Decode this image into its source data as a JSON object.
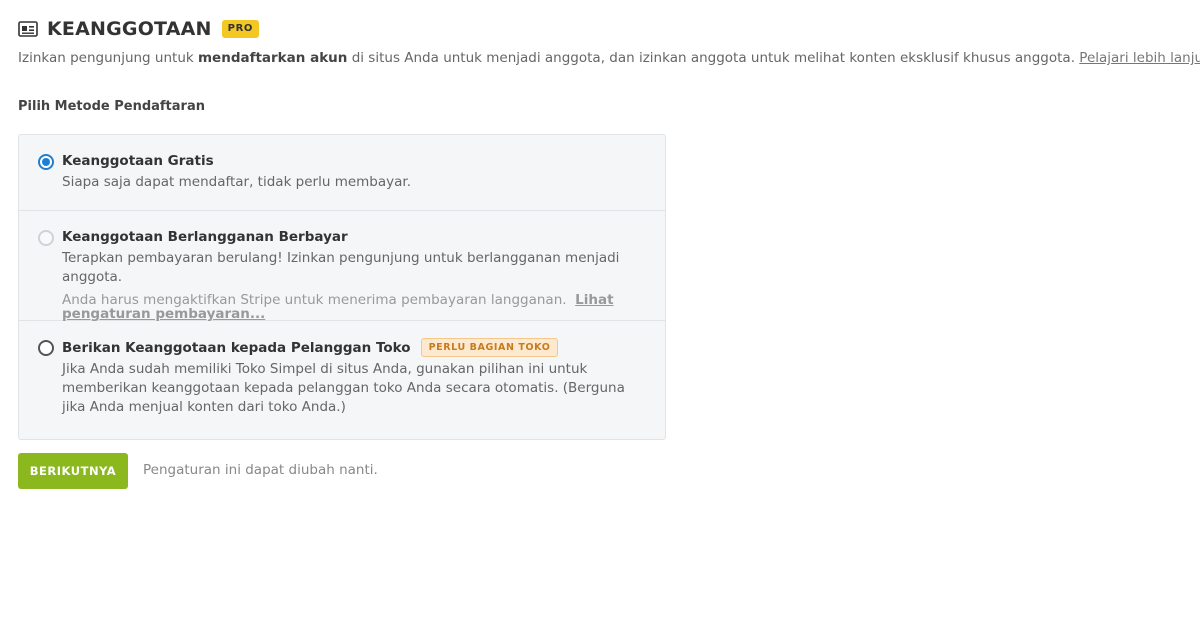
{
  "header": {
    "icon": "id-card-icon",
    "title": "KEANGGOTAAN",
    "badge": "PRO",
    "badge_color": "#f3c724"
  },
  "description": {
    "part1": "Izinkan pengunjung untuk ",
    "bold": "mendaftarkan akun",
    "part2": " di situs Anda untuk menjadi anggota, dan izinkan anggota untuk melihat konten eksklusif khusus anggota. ",
    "link": "Pelajari lebih lanjut."
  },
  "section_label": "Pilih Metode Pendaftaran",
  "options": [
    {
      "title": "Keanggotaan Gratis",
      "text": "Siapa saja dapat mendaftar, tidak perlu membayar.",
      "selected": true
    },
    {
      "title": "Keanggotaan Berlangganan Berbayar",
      "text": "Terapkan pembayaran berulang! Izinkan pengunjung untuk berlangganan menjadi anggota.",
      "note": "Anda harus mengaktifkan Stripe untuk menerima pembayaran langganan.",
      "note_link": "Lihat pengaturan pembayaran...",
      "disabled": true
    },
    {
      "title": "Berikan Keanggotaan kepada Pelanggan Toko",
      "badge": "PERLU BAGIAN TOKO",
      "text": "Jika Anda sudah memiliki Toko Simpel di situs Anda, gunakan pilihan ini untuk memberikan keanggotaan kepada pelanggan toko Anda secara otomatis. (Berguna jika Anda menjual konten dari toko Anda.)"
    }
  ],
  "footer": {
    "next_label": "BERIKUTNYA",
    "hint": "Pengaturan ini dapat diubah nanti."
  },
  "colors": {
    "accent": "#1e7fd2",
    "button": "#8bb81f",
    "toko_badge_bg": "#fde9cf",
    "toko_badge_text": "#c77b1c"
  }
}
